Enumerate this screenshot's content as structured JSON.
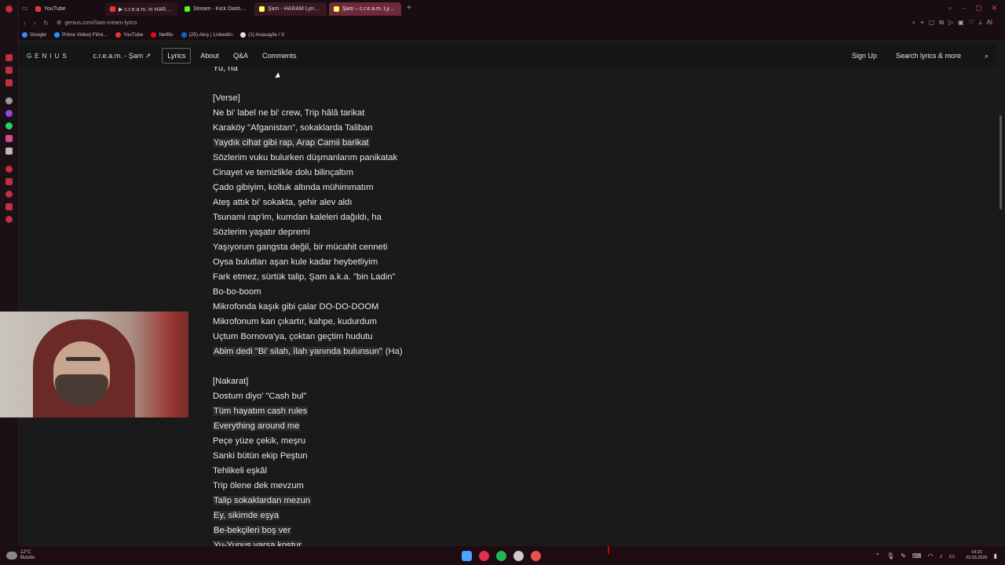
{
  "browser": {
    "tabs": [
      {
        "label": "YouTube",
        "favicon_color": "#e53935",
        "style": "normal"
      },
      {
        "label": "▶ c.r.e.a.m. in HARAM",
        "favicon_color": "#e53935",
        "style": "red-tab"
      },
      {
        "label": "Stream - Kick Dashboard",
        "favicon_color": "#53fc18",
        "style": "normal"
      },
      {
        "label": "Şam - HARAM Lyrics and",
        "favicon_color": "#ffff64",
        "style": "active"
      },
      {
        "label": "Şam – c.r.e.a.m. Lyrics |",
        "favicon_color": "#ffff64",
        "style": "highlight"
      }
    ],
    "new_tab": "+",
    "url": "genius.com/Sam-cream-lyrics",
    "bookmarks": [
      {
        "label": "Google",
        "color": "#4285f4"
      },
      {
        "label": "Prime Video| Filmi...",
        "color": "#1a98ff"
      },
      {
        "label": "YouTube",
        "color": "#e53935"
      },
      {
        "label": "Netflix",
        "color": "#e50914"
      },
      {
        "label": "(25) Akış | LinkedIn",
        "color": "#0a66c2"
      },
      {
        "label": "(1) Anasayfa / X",
        "color": "#dddddd"
      }
    ],
    "toolbar_ai": "AI"
  },
  "genius": {
    "logo": "GENIUS",
    "song": "c.r.e.a.m. - Şam ↗",
    "nav": [
      "Lyrics",
      "About",
      "Q&A",
      "Comments"
    ],
    "sign_up": "Sign Up",
    "search_placeholder": "Search lyrics & more"
  },
  "lyrics": [
    {
      "text": "Yu, ha",
      "hl": false
    },
    {
      "text": "",
      "hl": false
    },
    {
      "text": "[Verse]",
      "hl": false
    },
    {
      "text": "Ne bi' label ne bi' crew, Trip hâlâ tarikat",
      "hl": false
    },
    {
      "text": "Karaköy \"Afganistan\", sokaklarda Taliban",
      "hl": false
    },
    {
      "text": "Yaydık cihat gibi rap, Arap Camii barikat",
      "hl": true
    },
    {
      "text": "Sözlerim vuku bulurken düşmanlarım panikatak",
      "hl": false
    },
    {
      "text": "Cinayet ve temizlikle dolu bilinçaltım",
      "hl": false
    },
    {
      "text": "Çado gibiyim, koltuk altında mühimmatım",
      "hl": false
    },
    {
      "text": "Ateş attık bi' sokakta, şehir alev aldı",
      "hl": false
    },
    {
      "text": "Tsunami rap'im, kumdan kaleleri dağıldı, ha",
      "hl": false
    },
    {
      "text": "Sözlerim yaşatır depremi",
      "hl": false
    },
    {
      "text": "Yaşıyorum gangsta değil, bir mücahit cenneti",
      "hl": false
    },
    {
      "text": "Oysa bulutları aşan kule kadar heybetliyim",
      "hl": false
    },
    {
      "text": "Fark etmez, sürtük talip, Şam a.k.a. \"bin Ladin\"",
      "hl": false
    },
    {
      "text": "Bo-bo-boom",
      "hl": false
    },
    {
      "text": "Mikrofonda kaşık gibi çalar DO-DO-DOOM",
      "hl": false
    },
    {
      "text": "Mikrofonum kan çıkartır, kahpe, kudurdum",
      "hl": false
    },
    {
      "text": "Uçtum Bornova'ya, çoktan geçtim hudutu",
      "hl": false
    },
    {
      "text": "Abim dedi \"Bi' silah, İlah yanında bulunsun\"",
      "hl": true,
      "suffix": " (Ha)"
    },
    {
      "text": "",
      "hl": false
    },
    {
      "text": "[Nakarat]",
      "hl": false
    },
    {
      "text": "Dostum diyo' \"Cash bul\"",
      "hl": false
    },
    {
      "text": "Tüm hayatım cash rules",
      "hl": true
    },
    {
      "text": "Everything around me",
      "hl": true
    },
    {
      "text": "Peçe yüze çekik, meşru",
      "hl": false
    },
    {
      "text": "Sanki bütün ekip Peştun",
      "hl": false
    },
    {
      "text": "Tehlikeli eşkâl",
      "hl": false
    },
    {
      "text": "Trip ölene dek mevzum",
      "hl": false
    },
    {
      "text": "Talip sokaklardan mezun",
      "hl": true
    },
    {
      "text": "Ey, sikimde eşya",
      "hl": true
    },
    {
      "text": "Be-bekçileri boş ver",
      "hl": true
    },
    {
      "text": "Yu-Yunus varsa kostur",
      "hl": true
    }
  ],
  "taskbar": {
    "temperature": "12°C",
    "condition": "Bulutlu",
    "time": "14:23",
    "date": "22.03.2026",
    "apps": [
      {
        "name": "start",
        "color": "#4aa3ff"
      },
      {
        "name": "opera",
        "color": "#e03050"
      },
      {
        "name": "spotify",
        "color": "#1db954"
      },
      {
        "name": "chatgpt",
        "color": "#cccccc"
      },
      {
        "name": "chrome",
        "color": "#e5534b"
      }
    ]
  }
}
